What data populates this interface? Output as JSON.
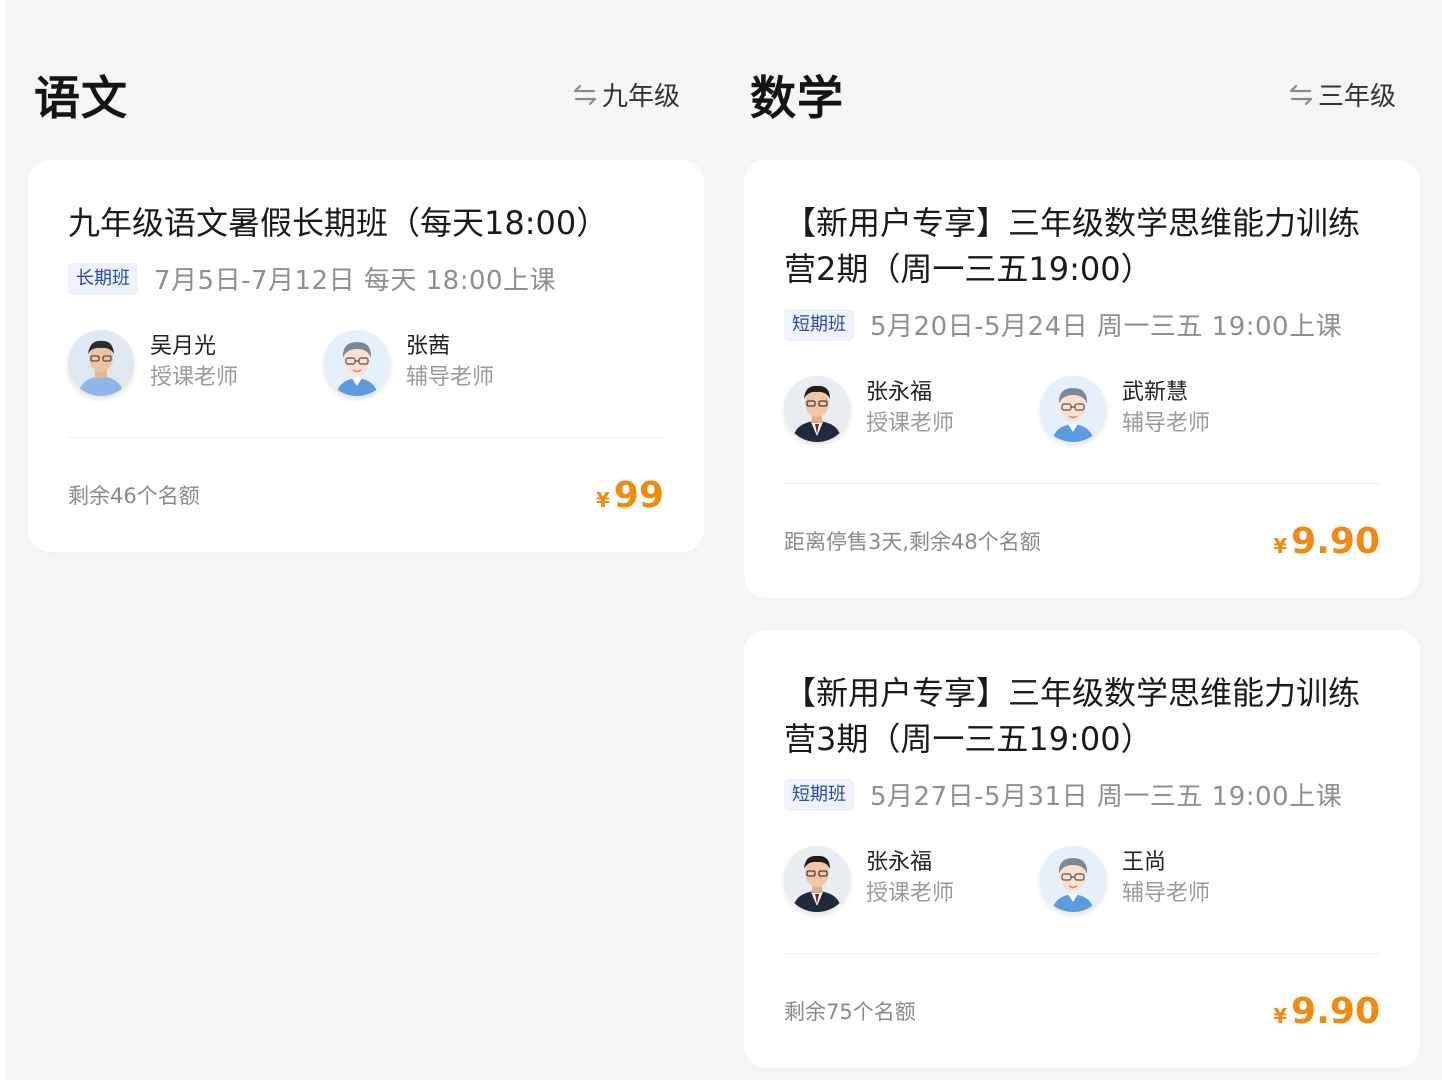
{
  "left_column": {
    "subject": "语文",
    "grade": "九年级",
    "courses": [
      {
        "title": "九年级语文暑假长期班（每天18:00）",
        "tag": "长期班",
        "schedule": "7月5日-7月12日 每天 18:00上课",
        "teachers": [
          {
            "name": "吴月光",
            "role": "授课老师",
            "avatar": "photo-avatar-man-icon"
          },
          {
            "name": "张茜",
            "role": "辅导老师",
            "avatar": "cartoon-avatar-teacher-icon"
          }
        ],
        "remain": "剩余46个名额",
        "currency": "¥",
        "price": "99"
      }
    ]
  },
  "right_column": {
    "subject": "数学",
    "grade": "三年级",
    "courses": [
      {
        "title": "【新用户专享】三年级数学思维能力训练营2期（周一三五19:00）",
        "tag": "短期班",
        "schedule": "5月20日-5月24日 周一三五 19:00上课",
        "teachers": [
          {
            "name": "张永福",
            "role": "授课老师",
            "avatar": "photo-avatar-suit-icon"
          },
          {
            "name": "武新慧",
            "role": "辅导老师",
            "avatar": "cartoon-avatar-teacher-icon"
          }
        ],
        "remain": "距离停售3天,剩余48个名额",
        "currency": "¥",
        "price": "9.90"
      },
      {
        "title": "【新用户专享】三年级数学思维能力训练营3期（周一三五19:00）",
        "tag": "短期班",
        "schedule": "5月27日-5月31日 周一三五 19:00上课",
        "teachers": [
          {
            "name": "张永福",
            "role": "授课老师",
            "avatar": "photo-avatar-suit-icon"
          },
          {
            "name": "王尚",
            "role": "辅导老师",
            "avatar": "cartoon-avatar-teacher-icon"
          }
        ],
        "remain": "剩余75个名额",
        "currency": "¥",
        "price": "9.90"
      }
    ]
  },
  "colors": {
    "background": "#f5f5f7",
    "card": "#ffffff",
    "price": "#f08a11",
    "tag_text": "#2a4c9e",
    "tag_bg": "#eef3fb",
    "muted": "#8f8f8f"
  },
  "icons": {
    "grade_switch": "swap-arrows-icon"
  }
}
